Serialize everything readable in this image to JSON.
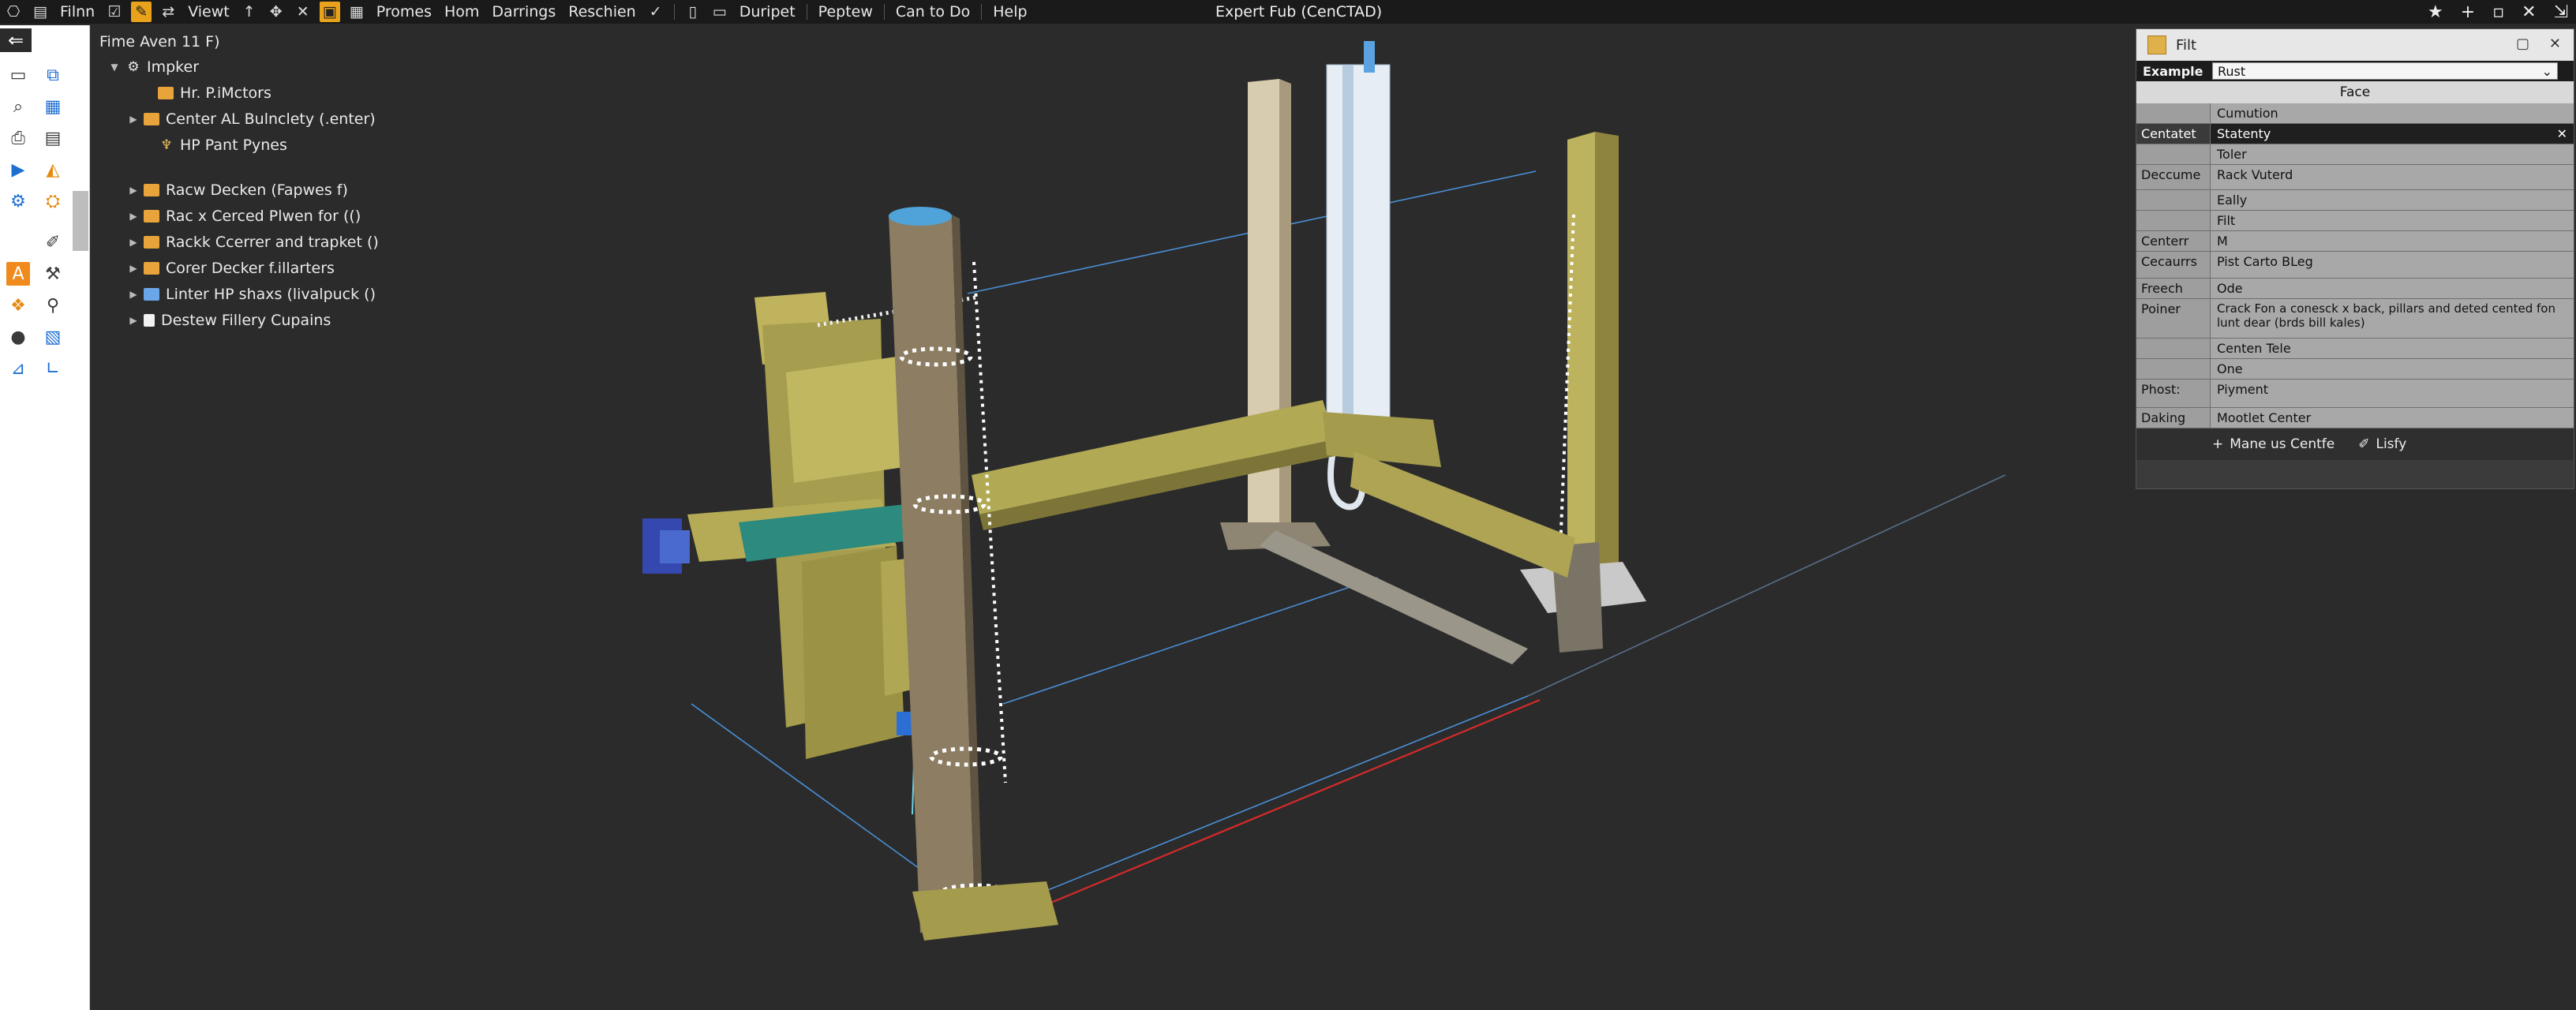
{
  "menubar": {
    "file": "Filnn",
    "view": "Viewt",
    "items": [
      "Promes",
      "Hom",
      "Darrings",
      "Reschien",
      "Duripet",
      "Peptew",
      "Can to Do",
      "Help"
    ]
  },
  "app_title": "Expert Fub (CenCTAD)",
  "tree": {
    "header": "Fime Aven 11 F)",
    "root": "Impker",
    "children": [
      "Hr. P.iMctors",
      "Center AL Bulnclety (.enter)",
      "HP Pant Pynes",
      "Racw Decken (Fapwes f)",
      "Rac x Cerced Plwen for (()",
      "Rackk Ccerrer and trapket ()",
      "Corer Decker f.illarters",
      "Linter HP shaxs (livalpuck ()",
      "Destew Fillery Cupains"
    ]
  },
  "props": {
    "title": "Filt",
    "example_label": "Example",
    "example_value": "Rust",
    "section": "Face",
    "rows": [
      {
        "k": "",
        "v": "Cumution"
      },
      {
        "k": "Centatet",
        "v": "Statenty"
      },
      {
        "k": "",
        "v": "Toler"
      },
      {
        "k": "Deccume",
        "v": "Rack Vuterd"
      },
      {
        "k": "",
        "v": "Eally"
      },
      {
        "k": "",
        "v": "Filt"
      },
      {
        "k": "Centerr",
        "v": "M"
      },
      {
        "k": "Cecaurrs",
        "v": "Pist Carto BLeg"
      },
      {
        "k": "Freech",
        "v": "Ode"
      },
      {
        "k": "Poiner",
        "v": "Crack Fon a conesck x back, pillars and deted cented fon lunt dear (brds bill kales)"
      },
      {
        "k": "",
        "v": "Centen Tele"
      },
      {
        "k": "",
        "v": "One"
      },
      {
        "k": "Phost:",
        "v": "Piyment"
      },
      {
        "k": "Daking",
        "v": "Mootlet Center"
      }
    ],
    "footer_add": "Mane us Centfe",
    "footer_lisfy": "Lisfy"
  },
  "colors": {
    "background": "#2b2b2b",
    "frame_olive": "#a39a4a",
    "post_tan": "#8c7d63",
    "accent_orange": "#e8a21b"
  }
}
